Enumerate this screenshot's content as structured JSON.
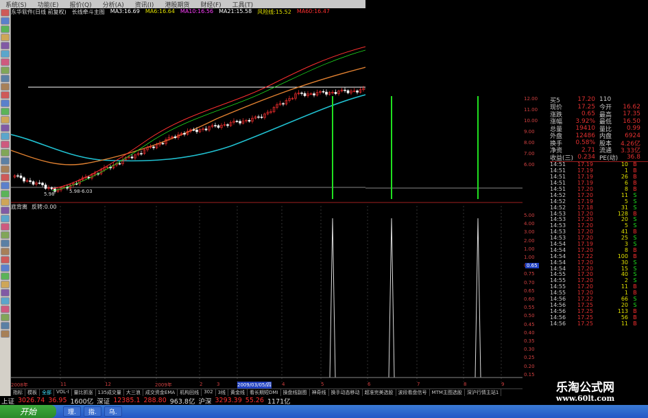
{
  "menu": [
    "系统(S)",
    "功能(E)",
    "报价(Q)",
    "分析(A)",
    "资讯(I)",
    "港股期货",
    "财经(F)",
    "工具(T)"
  ],
  "title": {
    "app": "东华软件(日线 前复权)",
    "indicator": "长线牵斗主图",
    "ma": [
      {
        "label": "MA3:16.69",
        "color": "#ffffff"
      },
      {
        "label": "MA6:16.64",
        "color": "#e0e000"
      },
      {
        "label": "MA10:16.56",
        "color": "#ff40ff"
      },
      {
        "label": "MA21:15.58",
        "color": "#ffffff"
      },
      {
        "label": "风险线:15.52",
        "color": "#e0e000"
      },
      {
        "label": "MA60:16.47",
        "color": "#ff3030"
      }
    ]
  },
  "chart": {
    "low_label": "5.98",
    "low_range_label": "5.98-6.03",
    "colors": {
      "up": "#ff3030",
      "down": "#20e0e0",
      "ma_cyan": "#20c0d0",
      "ma_orange": "#e08030",
      "hline": "#ffffff",
      "signal": "#20e020"
    }
  },
  "indicator_bar": {
    "name": "底背离",
    "value": "反转:0.00"
  },
  "right_scale": [
    "12.00",
    "11.00",
    "10.00",
    "9.00",
    "8.00",
    "7.00",
    "6.00",
    "5.00",
    "4.00",
    "3.00",
    "2.00",
    "1.00",
    "1.00",
    "0.80",
    "0.75",
    "0.70",
    "0.65",
    "0.60",
    "0.55",
    "0.50",
    "0.45",
    "0.40",
    "0.35",
    "0.30",
    "0.25",
    "0.20",
    "0.15"
  ],
  "indicator_marker": "0.65",
  "quote": {
    "top": [
      {
        "k": "买5",
        "v": "17.20",
        "k2": "110",
        "v2": ""
      },
      {
        "k": "现价",
        "v": "17.25",
        "k2": "今开",
        "v2": "16.62"
      },
      {
        "k": "涨跌",
        "v": "0.65",
        "k2": "最高",
        "v2": "17.35"
      },
      {
        "k": "涨幅",
        "v": "3.92%",
        "k2": "最低",
        "v2": "16.50"
      },
      {
        "k": "总量",
        "v": "19410",
        "k2": "量比",
        "v2": "0.99"
      },
      {
        "k": "外盘",
        "v": "12486",
        "k2": "内盘",
        "v2": "6924"
      },
      {
        "k": "换手",
        "v": "0.58%",
        "k2": "股本",
        "v2": "4.26亿"
      },
      {
        "k": "净资",
        "v": "2.71",
        "k2": "流通",
        "v2": "3.33亿"
      },
      {
        "k": "收益(三)",
        "v": "0.234",
        "k2": "PE(动)",
        "v2": "36.8"
      }
    ],
    "ticks": [
      [
        "14:51",
        "17.19",
        "10",
        "B"
      ],
      [
        "14:51",
        "17.19",
        "1",
        "B"
      ],
      [
        "14:51",
        "17.19",
        "26",
        "B"
      ],
      [
        "14:51",
        "17.19",
        "6",
        "B"
      ],
      [
        "14:51",
        "17.20",
        "8",
        "B"
      ],
      [
        "14:52",
        "17.20",
        "11",
        "S"
      ],
      [
        "14:52",
        "17.19",
        "5",
        "S"
      ],
      [
        "14:52",
        "17.18",
        "31",
        "S"
      ],
      [
        "14:53",
        "17.20",
        "128",
        "B"
      ],
      [
        "14:53",
        "17.20",
        "20",
        "S"
      ],
      [
        "14:53",
        "17.20",
        "5",
        "S"
      ],
      [
        "14:53",
        "17.20",
        "41",
        "B"
      ],
      [
        "14:53",
        "17.20",
        "25",
        "S"
      ],
      [
        "14:54",
        "17.19",
        "3",
        "S"
      ],
      [
        "14:54",
        "17.20",
        "8",
        "B"
      ],
      [
        "14:54",
        "17.22",
        "100",
        "B"
      ],
      [
        "14:54",
        "17.20",
        "30",
        "S"
      ],
      [
        "14:54",
        "17.20",
        "15",
        "S"
      ],
      [
        "14:55",
        "17.20",
        "40",
        "S"
      ],
      [
        "14:55",
        "17.20",
        "2",
        "S"
      ],
      [
        "14:55",
        "17.20",
        "11",
        "B"
      ],
      [
        "14:55",
        "17.20",
        "1",
        "B"
      ],
      [
        "14:56",
        "17.22",
        "66",
        "S"
      ],
      [
        "14:56",
        "17.25",
        "20",
        "S"
      ],
      [
        "14:56",
        "17.25",
        "113",
        "B"
      ],
      [
        "14:56",
        "17.25",
        "56",
        "B"
      ],
      [
        "14:56",
        "17.25",
        "11",
        "B"
      ]
    ]
  },
  "date_axis": [
    "2008年",
    "11",
    "12",
    "2009年",
    "2",
    "3",
    "2009/03/05/四",
    "4",
    "5",
    "6",
    "7",
    "8",
    "9"
  ],
  "tabs": [
    {
      "label": "指标",
      "active": false
    },
    {
      "label": "模板",
      "active": false
    },
    {
      "label": "全部",
      "active": true
    },
    {
      "label": "VOL-I",
      "active": false
    },
    {
      "label": "量比抓涨",
      "active": false
    },
    {
      "label": "135成交量",
      "active": false
    },
    {
      "label": "大三浪",
      "active": false
    },
    {
      "label": "成交资金EMA",
      "active": false
    },
    {
      "label": "机构回线",
      "active": false
    },
    {
      "label": "302",
      "active": false
    },
    {
      "label": "3线",
      "active": false
    },
    {
      "label": "黄金线",
      "active": false
    },
    {
      "label": "看长期短DMI",
      "active": false
    },
    {
      "label": "操盘线副图",
      "active": false
    },
    {
      "label": "神奇线",
      "active": false
    },
    {
      "label": "换手动态移动",
      "active": false
    },
    {
      "label": "超准完美选股",
      "active": false
    },
    {
      "label": "波段看盘信号",
      "active": false
    },
    {
      "label": "MTM主图选股",
      "active": false
    },
    {
      "label": "深沪行情主站1",
      "active": false
    }
  ],
  "status": [
    {
      "text": "上证",
      "cls": "w"
    },
    {
      "text": "3026.74",
      "cls": "r"
    },
    {
      "text": "36.95",
      "cls": "r"
    },
    {
      "text": "1600亿",
      "cls": "w"
    },
    {
      "text": "深证",
      "cls": "w"
    },
    {
      "text": "12385.1",
      "cls": "r"
    },
    {
      "text": "288.80",
      "cls": "r"
    },
    {
      "text": "963.8亿",
      "cls": "w"
    },
    {
      "text": "沪深",
      "cls": "w"
    },
    {
      "text": "3293.39",
      "cls": "r"
    },
    {
      "text": "55.26",
      "cls": "r"
    },
    {
      "text": "1171亿",
      "cls": "w"
    }
  ],
  "taskbar": {
    "start": "开始",
    "tasks": [
      "理.",
      "指.",
      "乌."
    ]
  },
  "watermark": {
    "line1": "乐淘公式网",
    "line2": "www.60lt.com"
  }
}
